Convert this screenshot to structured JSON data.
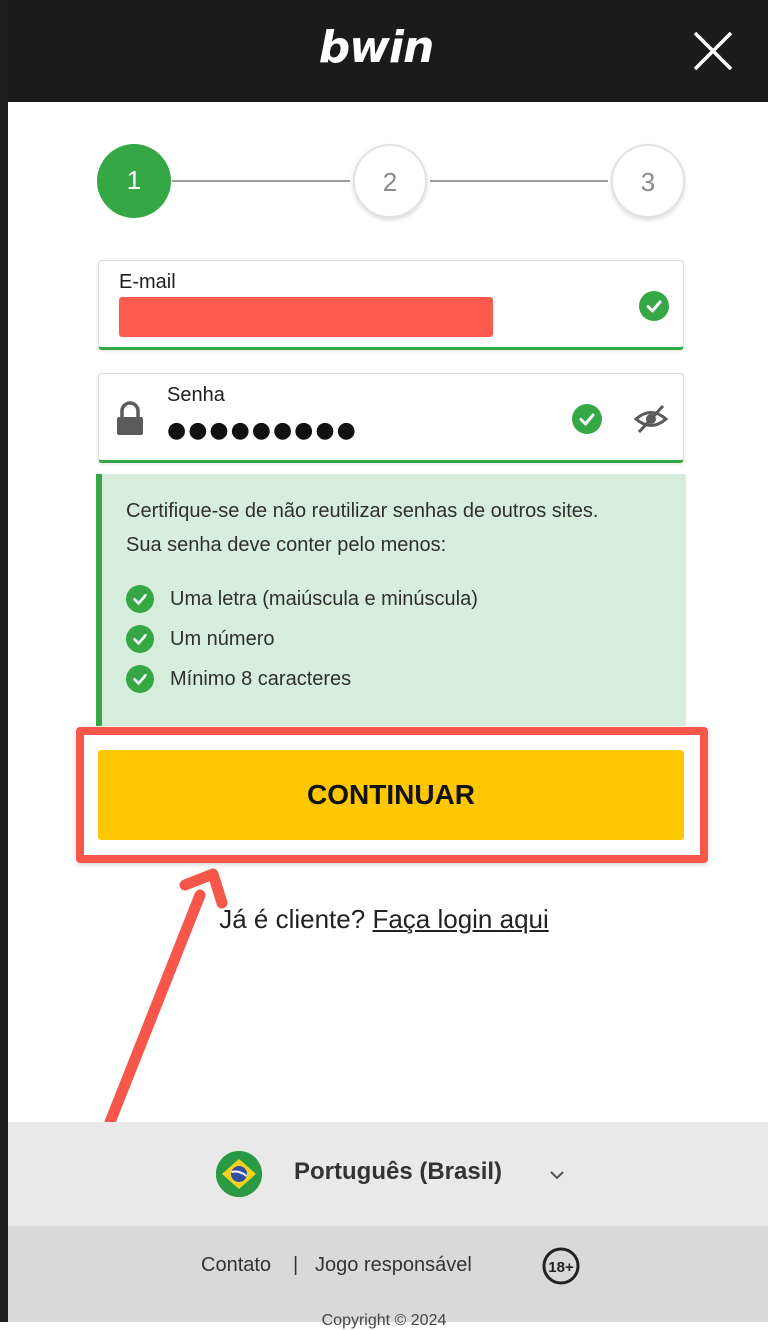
{
  "header": {
    "logo": "bwin",
    "close_icon": "close-icon"
  },
  "stepper": {
    "steps": [
      "1",
      "2",
      "3"
    ],
    "active_step": 1
  },
  "email": {
    "label": "E-mail",
    "value_redacted": true
  },
  "password": {
    "label": "Senha",
    "value": "●●●●●●●●●",
    "lock_icon": "lock-icon",
    "toggle_icon": "eye-off-icon"
  },
  "hint": {
    "line1": "Certifique-se de não reutilizar senhas de outros sites.",
    "line2": "Sua senha deve conter pelo menos:",
    "rules": [
      "Uma letra (maiúscula e minúscula)",
      "Um número",
      "Mínimo 8 caracteres"
    ]
  },
  "continue_label": "CONTINUAR",
  "login": {
    "prefix": "Já é cliente? ",
    "link": "Faça login aqui"
  },
  "language": {
    "label": "Português (Brasil)",
    "flag_icon": "brazil-flag-icon"
  },
  "footer": {
    "contact": "Contato",
    "separator": "|",
    "responsible": "Jogo responsável",
    "age_badge": "18+",
    "copyright": "Copyright © 2024"
  },
  "colors": {
    "accent_green": "#35a845",
    "button_yellow": "#fdc703",
    "annotation_red": "#f7564a",
    "header_bg": "#1b1b1b"
  }
}
